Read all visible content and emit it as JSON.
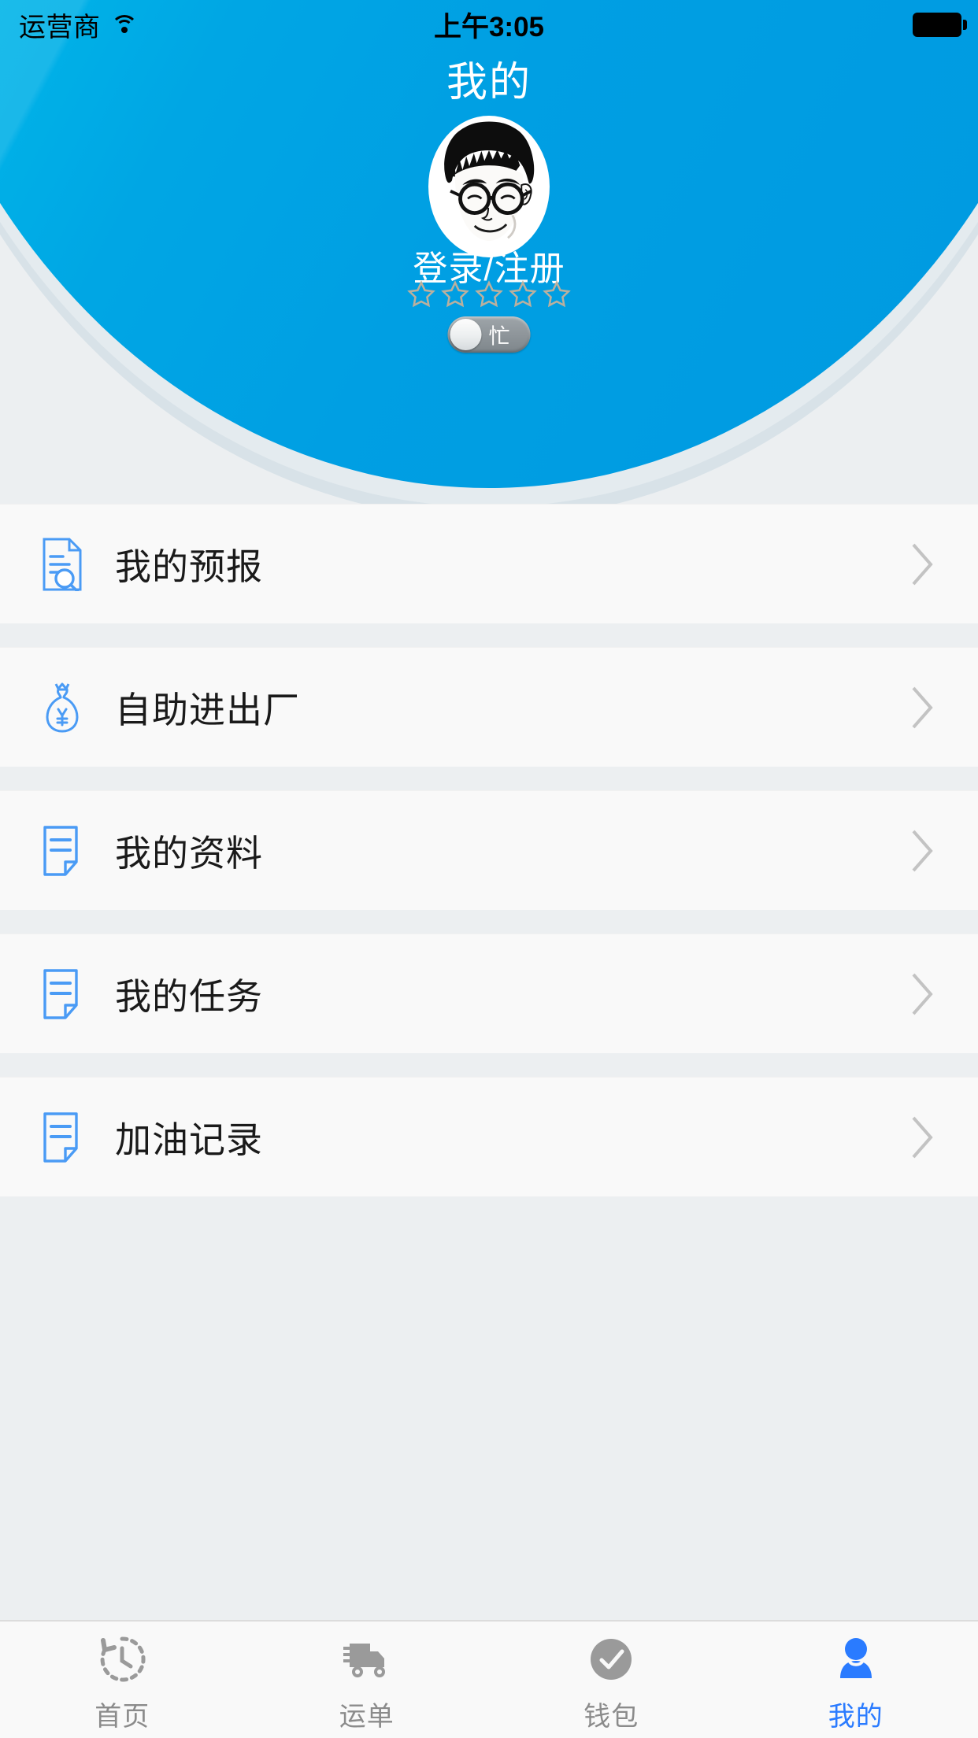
{
  "statusbar": {
    "carrier": "运营商",
    "wifi_icon": "wifi-icon",
    "time": "上午3:05",
    "battery_icon": "battery-full-icon"
  },
  "header": {
    "title": "我的",
    "avatar_icon": "avatar-cartoon-face",
    "login_label": "登录/注册",
    "rating": {
      "max": 5,
      "filled": 0,
      "star_icon": "star-outline-icon"
    },
    "status_toggle": {
      "label": "忙",
      "on": false,
      "knob_position": "left"
    },
    "gradient_from": "#00c6ef",
    "gradient_to": "#0099e0"
  },
  "menu": {
    "items": [
      {
        "label": "我的预报",
        "icon": "document-search-icon",
        "chevron": "chevron-right-icon"
      },
      {
        "label": "自助进出厂",
        "icon": "money-bag-yuan-icon",
        "chevron": "chevron-right-icon"
      },
      {
        "label": "我的资料",
        "icon": "document-lines-icon",
        "chevron": "chevron-right-icon"
      },
      {
        "label": "我的任务",
        "icon": "document-lines-icon",
        "chevron": "chevron-right-icon"
      },
      {
        "label": "加油记录",
        "icon": "document-lines-icon",
        "chevron": "chevron-right-icon"
      }
    ],
    "icon_color": "#4a9bf5"
  },
  "tabbar": {
    "active_color": "#2a7bff",
    "inactive_color": "#8b8b8b",
    "tabs": [
      {
        "label": "首页",
        "icon": "clock-history-icon",
        "active": false
      },
      {
        "label": "运单",
        "icon": "truck-icon",
        "active": false
      },
      {
        "label": "钱包",
        "icon": "check-circle-icon",
        "active": false
      },
      {
        "label": "我的",
        "icon": "person-icon",
        "active": true
      }
    ]
  }
}
